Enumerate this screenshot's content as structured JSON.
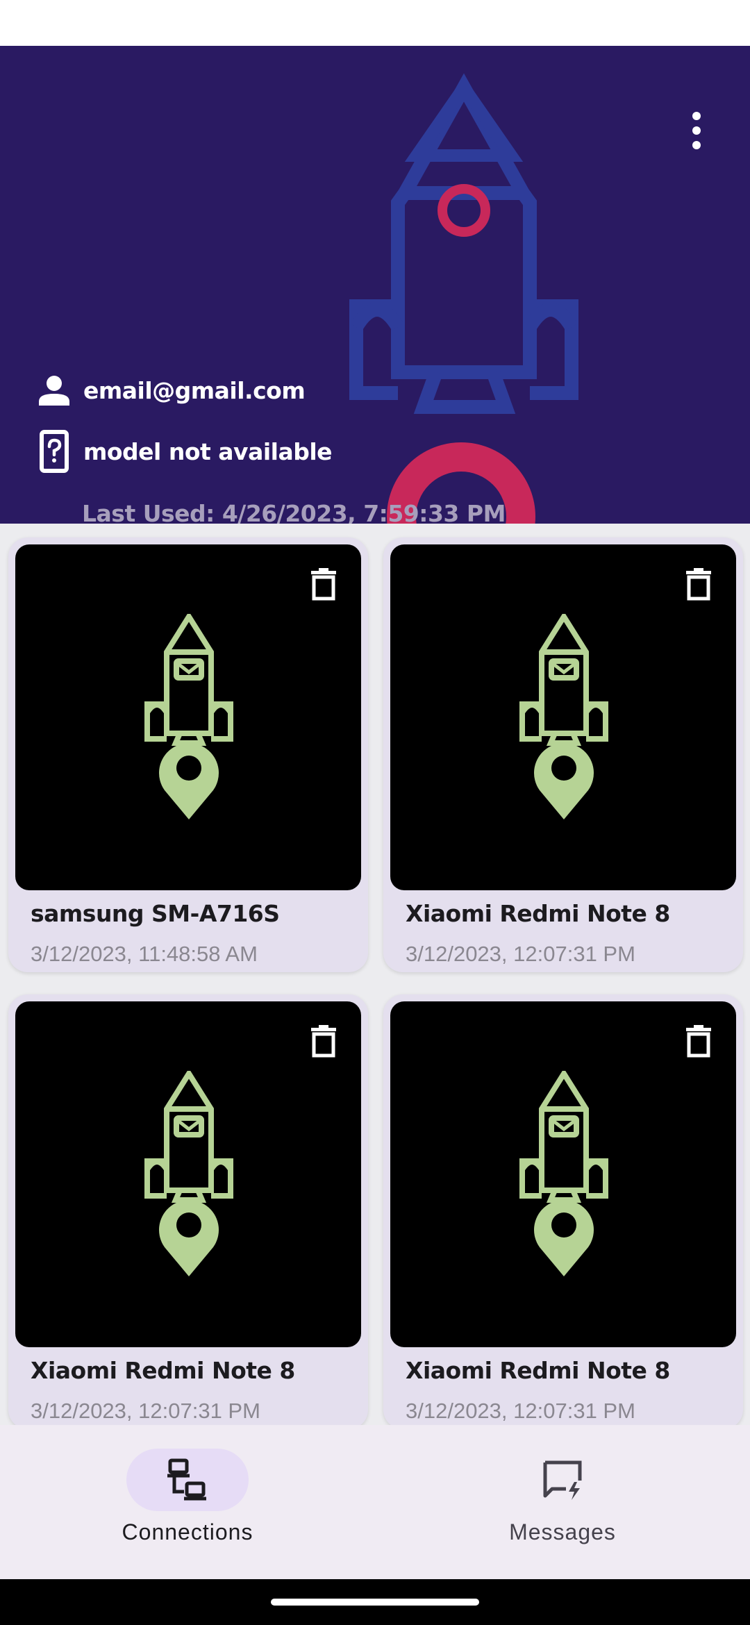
{
  "header": {
    "email": "email@gmail.com",
    "model": "model not available",
    "last_used": "Last Used: 4/26/2023, 7:59:33 PM",
    "menu_icon": "more-vert-icon",
    "person_icon": "person-icon",
    "phone_icon": "device-unknown-icon",
    "background_color": "#2a1a62",
    "art_color_blue": "#2e3c9a",
    "art_color_red": "#c8285a"
  },
  "devices": [
    {
      "name": "samsung SM-A716S",
      "date": "3/12/2023, 11:48:58 AM"
    },
    {
      "name": "Xiaomi Redmi Note 8",
      "date": "3/12/2023, 12:07:31 PM"
    },
    {
      "name": "Xiaomi Redmi Note 8",
      "date": "3/12/2023, 12:07:31 PM"
    },
    {
      "name": "Xiaomi Redmi Note 8",
      "date": "3/12/2023, 12:07:31 PM"
    }
  ],
  "device_card": {
    "delete_icon": "trash-icon",
    "thumbnail_icon": "rocket-location-icon",
    "thumbnail_color": "#b6d395"
  },
  "bottom_nav": {
    "items": [
      {
        "label": "Connections",
        "icon": "devices-icon",
        "active": true
      },
      {
        "label": "Messages",
        "icon": "message-flash-icon",
        "active": false
      }
    ],
    "active_indicator_color": "#e6dcf6"
  }
}
